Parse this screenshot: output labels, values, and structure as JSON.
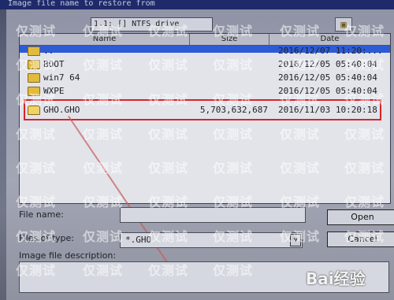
{
  "dialog": {
    "title": "Image file name to restore from",
    "look_in_value": "1.1: [] NTFS drive"
  },
  "columns": {
    "name": "Name",
    "size": "Size",
    "date": "Date"
  },
  "files": [
    {
      "name": "..",
      "size": "",
      "date": "2016/12/07 11:20:...",
      "type": "up"
    },
    {
      "name": "BOOT",
      "size": "",
      "date": "2016/12/05 05:40:04",
      "type": "folder"
    },
    {
      "name": "win7 64",
      "size": "",
      "date": "2016/12/05 05:40:04",
      "type": "folder"
    },
    {
      "name": "WXPE",
      "size": "",
      "date": "2016/12/05 05:40:04",
      "type": "folder"
    },
    {
      "name": "GHO.GHO",
      "size": "5,703,632,687",
      "date": "2016/11/03 10:20:18",
      "type": "file"
    }
  ],
  "form": {
    "file_name_label": "File name:",
    "file_name_value": "",
    "files_of_type_label": "Files of type:",
    "files_of_type_value": "*.GHO",
    "desc_label": "Image file description:",
    "desc_value": ""
  },
  "buttons": {
    "open": "Open",
    "cancel": "Cancel"
  },
  "watermark_text": "仅测试",
  "brand_text": "Bai经验"
}
